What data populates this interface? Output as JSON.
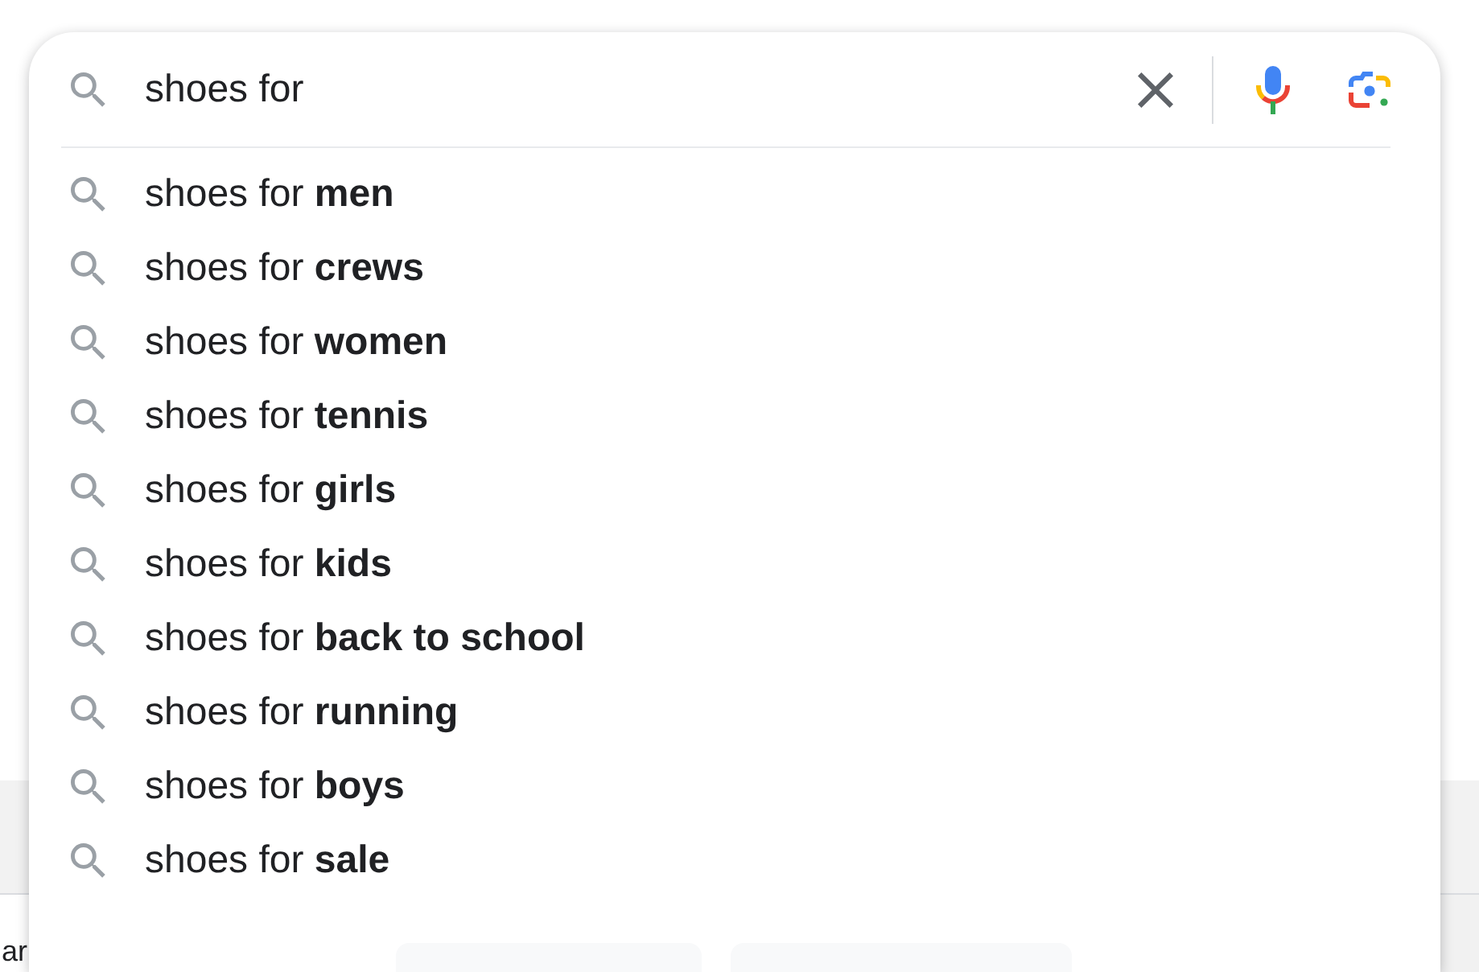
{
  "search": {
    "value": "shoes for"
  },
  "suggestions": [
    {
      "text": "shoes for **men**"
    },
    {
      "text": "shoes for **crews**"
    },
    {
      "text": "shoes for **women**"
    },
    {
      "text": "shoes for **tennis**"
    },
    {
      "text": "shoes for **girls**"
    },
    {
      "text": "shoes for **kids**"
    },
    {
      "text": "shoes for **back to school**"
    },
    {
      "text": "shoes for **running**"
    },
    {
      "text": "shoes for **boys**"
    },
    {
      "text": "shoes for **sale**"
    }
  ],
  "background": {
    "partial_text": "ar"
  }
}
